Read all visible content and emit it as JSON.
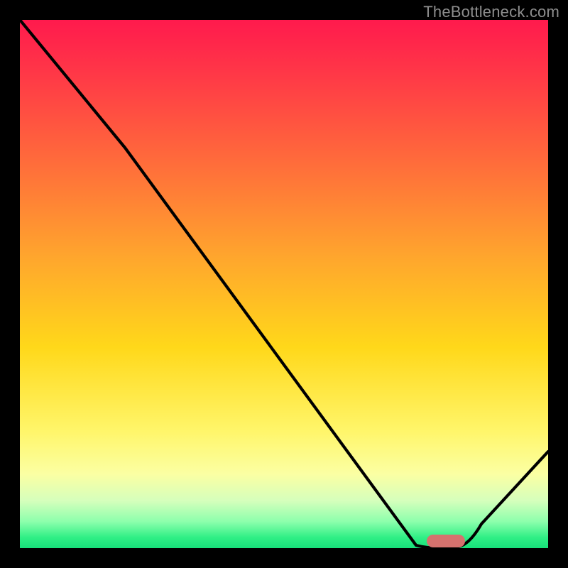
{
  "watermark": "TheBottleneck.com",
  "colors": {
    "frame": "#000000",
    "curve": "#000000",
    "marker": "#d5726e",
    "gradient_top": "#ff1a4d",
    "gradient_bottom": "#17e07a"
  },
  "chart_data": {
    "type": "line",
    "title": "",
    "xlabel": "",
    "ylabel": "",
    "xlim": [
      0,
      100
    ],
    "ylim": [
      0,
      100
    ],
    "x": [
      0,
      5,
      10,
      15,
      20,
      25,
      30,
      35,
      40,
      45,
      50,
      55,
      60,
      65,
      70,
      75,
      77,
      80,
      83,
      88,
      93,
      100
    ],
    "values": [
      100,
      94,
      88,
      82,
      75.5,
      70.5,
      63,
      55.5,
      48,
      40.5,
      33,
      25.5,
      18,
      11,
      4.5,
      0.5,
      0,
      0,
      0.3,
      5,
      10.5,
      18
    ],
    "marker": {
      "x_start": 77.5,
      "x_end": 84.5,
      "y": 1.0
    },
    "note": "Values are read as percentages of plot height above baseline; 100 = top, 0 = bottom. Curve has a kink near x≈20 and a flat minimum from x≈75–83 at y≈0, then rises toward x=100."
  }
}
